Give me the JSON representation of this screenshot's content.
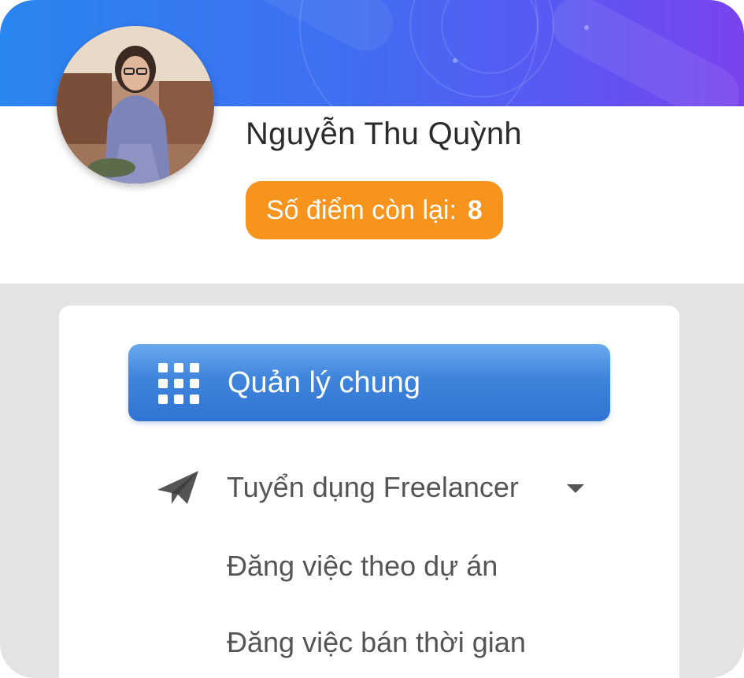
{
  "profile": {
    "name": "Nguyễn Thu Quỳnh",
    "points_label": "Số điểm còn lại:",
    "points_value": "8"
  },
  "menu": {
    "active_item": {
      "label": "Quản lý chung",
      "icon": "grid-icon"
    },
    "items": [
      {
        "label": "Tuyển dụng Freelancer",
        "icon": "paper-plane-icon",
        "has_dropdown": true
      },
      {
        "label": "Đăng việc theo dự án"
      },
      {
        "label": "Đăng việc bán thời gian"
      }
    ]
  },
  "colors": {
    "banner_start": "#2a86f0",
    "banner_end": "#7a43ee",
    "badge": "#f7941d",
    "active_menu": "#3f84dc"
  }
}
